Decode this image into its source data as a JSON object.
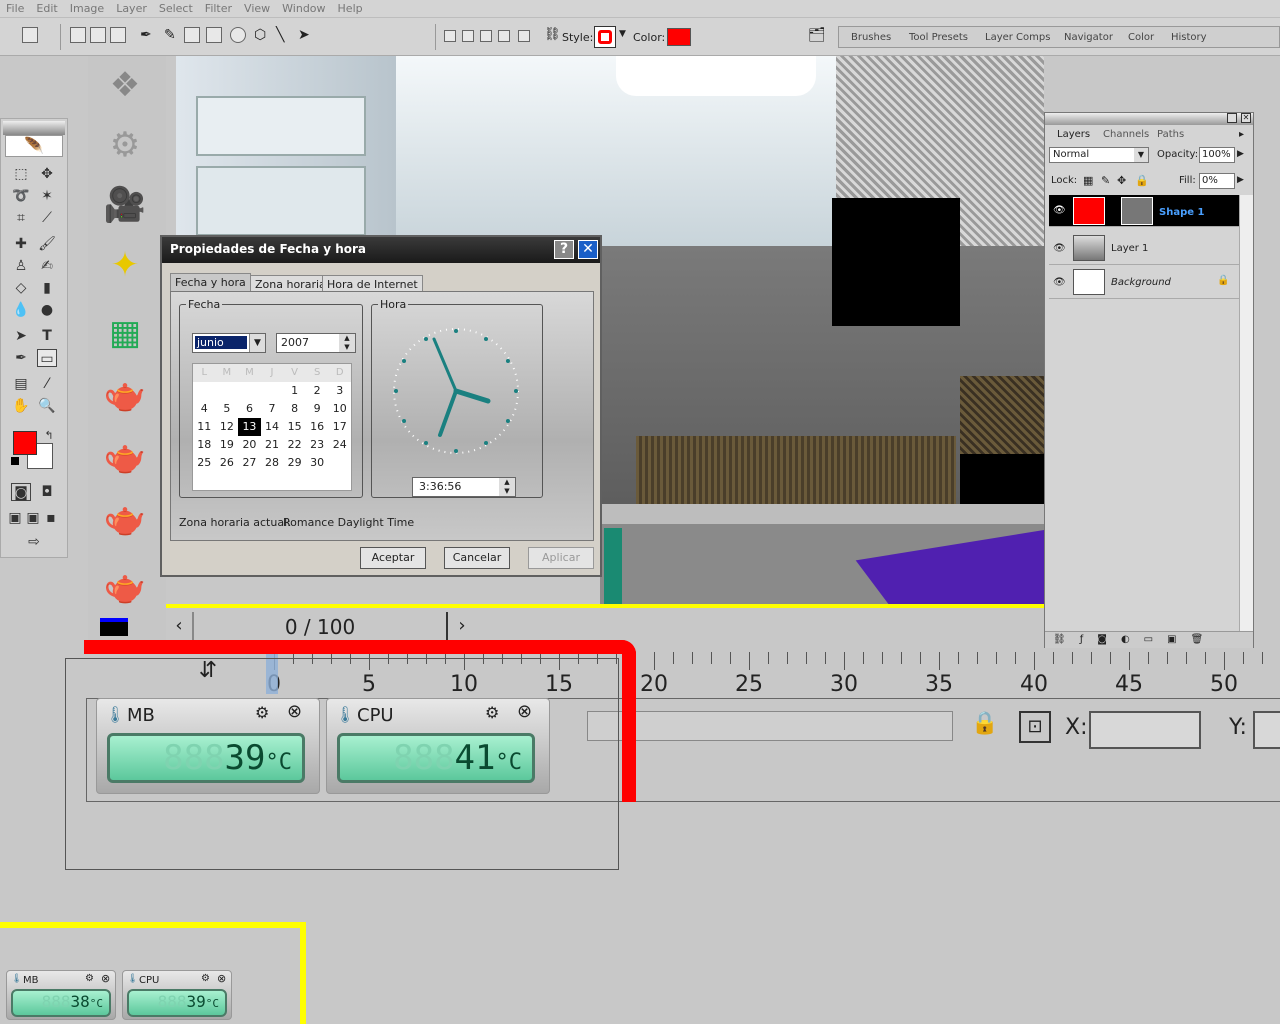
{
  "menu": [
    "File",
    "Edit",
    "Image",
    "Layer",
    "Select",
    "Filter",
    "View",
    "Window",
    "Help"
  ],
  "options": {
    "style_label": "Style:",
    "color_label": "Color:",
    "style_color": "#ff0000",
    "fill_color": "#ff0000"
  },
  "palette_well": [
    "Brushes",
    "Tool Presets",
    "Layer Comps",
    "Navigator",
    "Color",
    "History"
  ],
  "dialog": {
    "title": "Propiedades de Fecha y hora",
    "help": "?",
    "close": "✕",
    "tabs": [
      "Fecha y hora",
      "Zona horaria",
      "Hora de Internet"
    ],
    "date_group": "Fecha",
    "time_group": "Hora",
    "month": "junio",
    "year": "2007",
    "weekdays": [
      "L",
      "M",
      "M",
      "J",
      "V",
      "S",
      "D"
    ],
    "weeks": [
      [
        "",
        "",
        "",
        "",
        "1",
        "2",
        "3"
      ],
      [
        "4",
        "5",
        "6",
        "7",
        "8",
        "9",
        "10"
      ],
      [
        "11",
        "12",
        "13",
        "14",
        "15",
        "16",
        "17"
      ],
      [
        "18",
        "19",
        "20",
        "21",
        "22",
        "23",
        "24"
      ],
      [
        "25",
        "26",
        "27",
        "28",
        "29",
        "30",
        ""
      ]
    ],
    "selected_day": "13",
    "time": "3:36:56",
    "timezone_label": "Zona horaria actual:",
    "timezone": "Romance Daylight Time",
    "ok": "Aceptar",
    "cancel": "Cancelar",
    "apply": "Aplicar"
  },
  "layers_panel": {
    "tabs": [
      "Layers",
      "Channels",
      "Paths"
    ],
    "blend_mode": "Normal",
    "opacity_label": "Opacity:",
    "opacity": "100%",
    "lock_label": "Lock:",
    "fill_label": "Fill:",
    "fill": "0%",
    "layers": [
      "Shape 1",
      "Layer 1",
      "Background"
    ]
  },
  "frame_counter": "0 / 100",
  "timeline": {
    "labels": [
      "0",
      "5",
      "10",
      "15",
      "20",
      "25",
      "30",
      "35",
      "40",
      "45",
      "50"
    ],
    "x_label": "X:",
    "y_label": "Y:"
  },
  "temps_large": [
    {
      "name": "MB",
      "value": "39",
      "unit": "°C"
    },
    {
      "name": "CPU",
      "value": "41",
      "unit": "°C"
    }
  ],
  "temps_small": [
    {
      "name": "MB",
      "value": "38",
      "unit": "°C"
    },
    {
      "name": "CPU",
      "value": "39",
      "unit": "°C"
    }
  ]
}
